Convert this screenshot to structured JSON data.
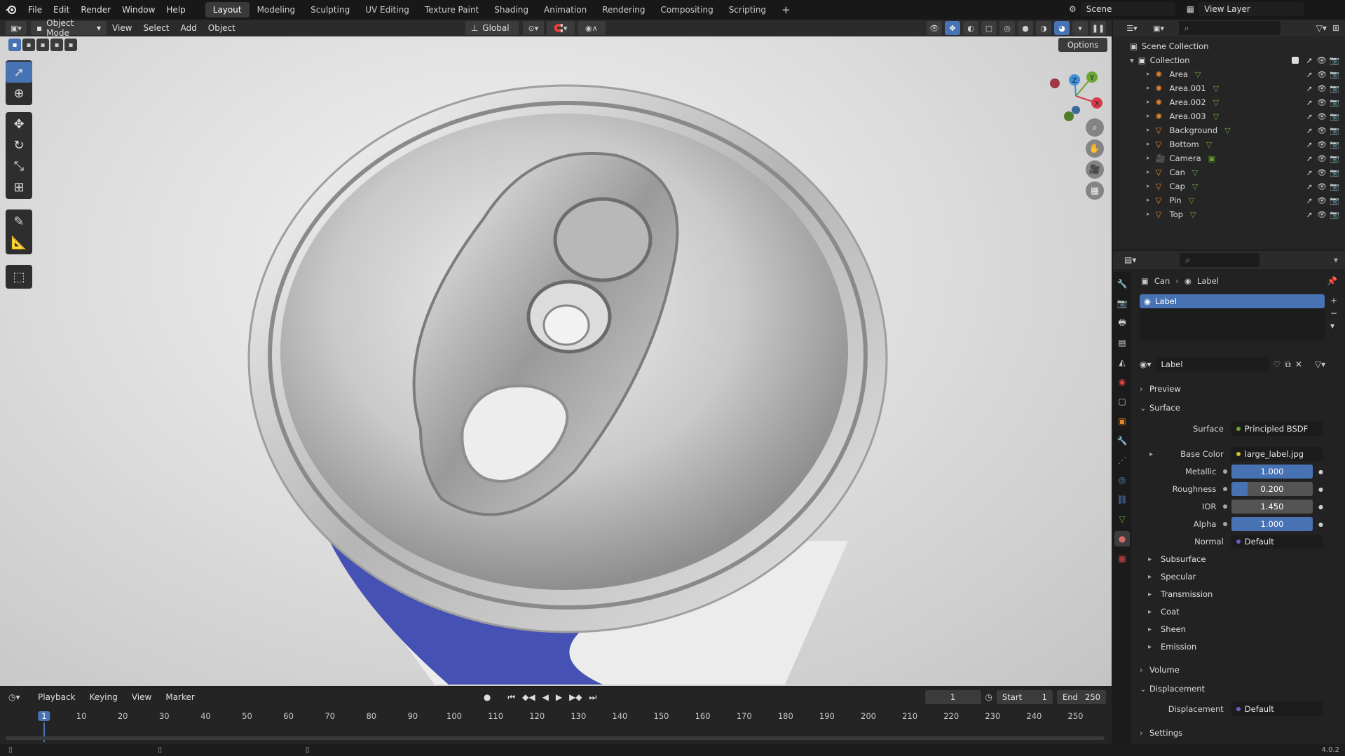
{
  "topbar": {
    "menus": [
      "File",
      "Edit",
      "Render",
      "Window",
      "Help"
    ],
    "workspaces": [
      "Layout",
      "Modeling",
      "Sculpting",
      "UV Editing",
      "Texture Paint",
      "Shading",
      "Animation",
      "Rendering",
      "Compositing",
      "Scripting"
    ],
    "active_workspace": "Layout",
    "add_tab": "+",
    "scene": "Scene",
    "view_layer": "View Layer"
  },
  "viewport_header": {
    "mode": "Object Mode",
    "menus": [
      "View",
      "Select",
      "Add",
      "Object"
    ],
    "orientation": "Global",
    "options": "Options"
  },
  "gizmo": {
    "x": "X",
    "y": "Y",
    "z": "Z"
  },
  "outliner": {
    "root": "Scene Collection",
    "collection": "Collection",
    "items": [
      {
        "name": "Area",
        "type": "light"
      },
      {
        "name": "Area.001",
        "type": "light"
      },
      {
        "name": "Area.002",
        "type": "light"
      },
      {
        "name": "Area.003",
        "type": "light"
      },
      {
        "name": "Background",
        "type": "mesh"
      },
      {
        "name": "Bottom",
        "type": "mesh"
      },
      {
        "name": "Camera",
        "type": "camera"
      },
      {
        "name": "Can",
        "type": "mesh"
      },
      {
        "name": "Cap",
        "type": "mesh"
      },
      {
        "name": "Pin",
        "type": "mesh"
      },
      {
        "name": "Top",
        "type": "mesh"
      }
    ]
  },
  "properties": {
    "breadcrumb_object": "Can",
    "breadcrumb_material": "Label",
    "slot": "Label",
    "material_name": "Label",
    "panels": {
      "preview": "Preview",
      "surface": "Surface",
      "volume": "Volume",
      "displacement": "Displacement",
      "settings": "Settings"
    },
    "surface_shader_label": "Surface",
    "surface_shader": "Principled BSDF",
    "base_color_label": "Base Color",
    "base_color": "large_label.jpg",
    "metallic_label": "Metallic",
    "metallic": "1.000",
    "metallic_fraction": 1.0,
    "roughness_label": "Roughness",
    "roughness": "0.200",
    "roughness_fraction": 0.2,
    "ior_label": "IOR",
    "ior": "1.450",
    "alpha_label": "Alpha",
    "alpha": "1.000",
    "alpha_fraction": 1.0,
    "normal_label": "Normal",
    "normal": "Default",
    "subpanels": [
      "Subsurface",
      "Specular",
      "Transmission",
      "Coat",
      "Sheen",
      "Emission"
    ],
    "displacement_label": "Displacement",
    "displacement": "Default"
  },
  "timeline": {
    "menus": [
      "Playback",
      "Keying",
      "View",
      "Marker"
    ],
    "current_frame": "1",
    "start_label": "Start",
    "start": "1",
    "end_label": "End",
    "end": "250",
    "ticks": [
      "1",
      "10",
      "20",
      "30",
      "40",
      "50",
      "60",
      "70",
      "80",
      "90",
      "100",
      "110",
      "120",
      "130",
      "140",
      "150",
      "160",
      "170",
      "180",
      "190",
      "200",
      "210",
      "220",
      "230",
      "240",
      "250"
    ]
  },
  "statusbar": {
    "version": "4.0.2"
  },
  "colors": {
    "accent": "#4772b3",
    "x_axis": "#d63a4b",
    "y_axis": "#6aa534",
    "z_axis": "#3d8fd6"
  }
}
